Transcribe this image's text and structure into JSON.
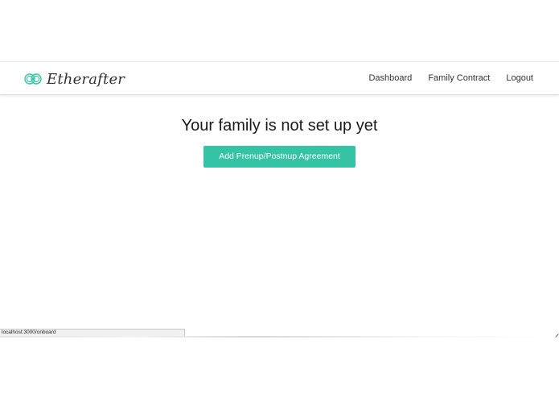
{
  "brand": {
    "name": "Etherafter",
    "logo_icon": "interlocking-rings-icon",
    "accent_color": "#35c3a6"
  },
  "nav": {
    "links": [
      {
        "label": "Dashboard"
      },
      {
        "label": "Family Contract"
      },
      {
        "label": "Logout"
      }
    ]
  },
  "main": {
    "headline": "Your family is not set up yet",
    "cta_label": "Add Prenup/Postnup Agreement"
  },
  "status_bar": {
    "url": "localhost:3000/onboard"
  }
}
